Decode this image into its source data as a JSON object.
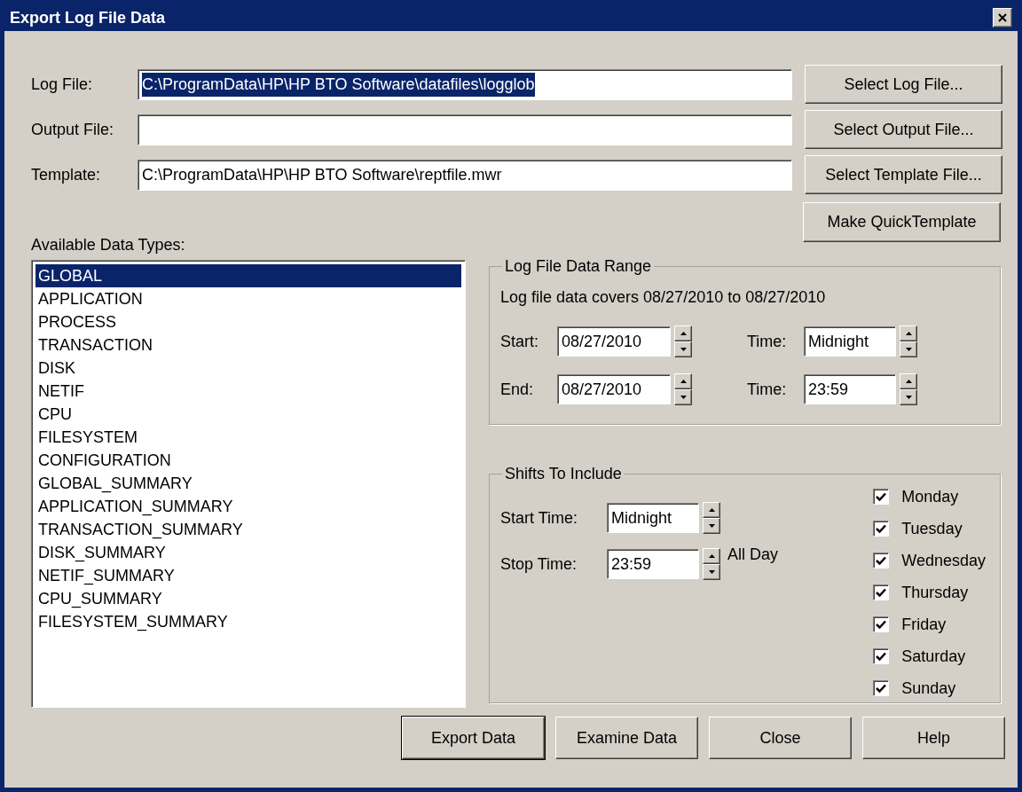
{
  "window": {
    "title": "Export Log File Data"
  },
  "files": [
    {
      "label": "Log File:",
      "value": "C:\\ProgramData\\HP\\HP BTO Software\\datafiles\\logglob",
      "highlighted": true,
      "button": "Select Log File..."
    },
    {
      "label": "Output File:",
      "button": "Select Output File..."
    },
    {
      "label": "Template:",
      "value": "C:\\ProgramData\\HP\\HP BTO Software\\reptfile.mwr",
      "highlighted": false,
      "button": "Select Template File..."
    }
  ],
  "quick_template_button": "Make QuickTemplate",
  "data_types": {
    "label": "Available Data Types:",
    "items": [
      {
        "label": "GLOBAL",
        "selected": true
      },
      {
        "label": "APPLICATION",
        "selected": false
      },
      {
        "label": "PROCESS",
        "selected": false
      },
      {
        "label": "TRANSACTION",
        "selected": false
      },
      {
        "label": "DISK",
        "selected": false
      },
      {
        "label": "NETIF",
        "selected": false
      },
      {
        "label": "CPU",
        "selected": false
      },
      {
        "label": "FILESYSTEM",
        "selected": false
      },
      {
        "label": "CONFIGURATION",
        "selected": false
      },
      {
        "label": "GLOBAL_SUMMARY",
        "selected": false
      },
      {
        "label": "APPLICATION_SUMMARY",
        "selected": false
      },
      {
        "label": "TRANSACTION_SUMMARY",
        "selected": false
      },
      {
        "label": "DISK_SUMMARY",
        "selected": false
      },
      {
        "label": "NETIF_SUMMARY",
        "selected": false
      },
      {
        "label": "CPU_SUMMARY",
        "selected": false
      },
      {
        "label": "FILESYSTEM_SUMMARY",
        "selected": false
      }
    ]
  },
  "data_range": {
    "title": "Log File Data Range",
    "coverage": "Log file data covers 08/27/2010 to 08/27/2010",
    "rows": [
      {
        "date_label": "Start:",
        "date": "08/27/2010",
        "time_label": "Time:",
        "time": "Midnight"
      },
      {
        "date_label": "End:",
        "date": "08/27/2010",
        "time_label": "Time:",
        "time": "23:59"
      }
    ]
  },
  "shifts": {
    "title": "Shifts To Include",
    "summary": "All Day",
    "times": [
      {
        "label": "Start Time:",
        "value": "Midnight"
      },
      {
        "label": "Stop Time:",
        "value": "23:59"
      }
    ],
    "days": [
      {
        "label": "Monday",
        "checked": true
      },
      {
        "label": "Tuesday",
        "checked": true
      },
      {
        "label": "Wednesday",
        "checked": true
      },
      {
        "label": "Thursday",
        "checked": true
      },
      {
        "label": "Friday",
        "checked": true
      },
      {
        "label": "Saturday",
        "checked": true
      },
      {
        "label": "Sunday",
        "checked": true
      }
    ]
  },
  "buttons": [
    {
      "label": "Export Data",
      "default": true
    },
    {
      "label": "Examine Data",
      "default": false
    },
    {
      "label": "Close",
      "default": false
    },
    {
      "label": "Help",
      "default": false
    }
  ]
}
